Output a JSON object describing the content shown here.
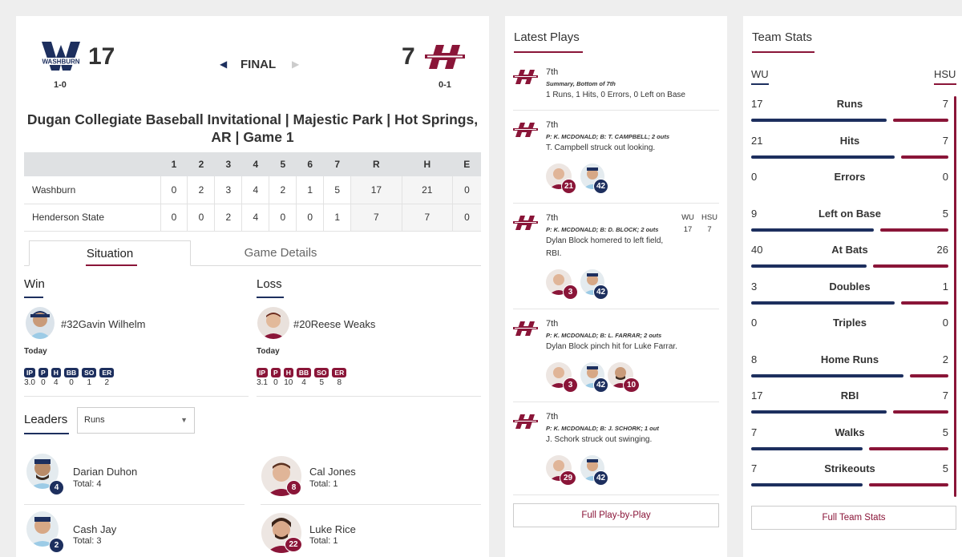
{
  "score": {
    "home_team_abbr": "WU",
    "home_score": "17",
    "home_record": "1-0",
    "away_team_abbr": "HSU",
    "away_score": "7",
    "away_record": "0-1",
    "status": "FINAL",
    "home_logo_text": "WASHBURN"
  },
  "game_title": "Dugan Collegiate Baseball Invitational | Majestic Park | Hot Springs, AR | Game 1",
  "linescore": {
    "headers": [
      "",
      "1",
      "2",
      "3",
      "4",
      "5",
      "6",
      "7",
      "R",
      "H",
      "E"
    ],
    "rows": [
      {
        "team": "Washburn",
        "innings": [
          "0",
          "2",
          "3",
          "4",
          "2",
          "1",
          "5"
        ],
        "r": "17",
        "h": "21",
        "e": "0"
      },
      {
        "team": "Henderson State",
        "innings": [
          "0",
          "0",
          "2",
          "4",
          "0",
          "0",
          "1"
        ],
        "r": "7",
        "h": "7",
        "e": "0"
      }
    ]
  },
  "tabs": {
    "situation": "Situation",
    "details": "Game Details"
  },
  "win": {
    "heading": "Win",
    "player": "#32Gavin Wilhelm",
    "when": "Today",
    "stats": [
      {
        "k": "IP",
        "v": "3.0"
      },
      {
        "k": "P",
        "v": "0"
      },
      {
        "k": "H",
        "v": "4"
      },
      {
        "k": "BB",
        "v": "0"
      },
      {
        "k": "SO",
        "v": "1"
      },
      {
        "k": "ER",
        "v": "2"
      }
    ]
  },
  "loss": {
    "heading": "Loss",
    "player": "#20Reese Weaks",
    "when": "Today",
    "stats": [
      {
        "k": "IP",
        "v": "3.1"
      },
      {
        "k": "P",
        "v": "0"
      },
      {
        "k": "H",
        "v": "10"
      },
      {
        "k": "BB",
        "v": "4"
      },
      {
        "k": "SO",
        "v": "5"
      },
      {
        "k": "ER",
        "v": "8"
      }
    ]
  },
  "leaders": {
    "heading": "Leaders",
    "select_value": "Runs",
    "items": [
      {
        "name": "Darian Duhon",
        "total": "Total: 4",
        "num": "4",
        "team": "wu"
      },
      {
        "name": "Cal Jones",
        "total": "Total: 1",
        "num": "8",
        "team": "hs"
      },
      {
        "name": "Cash Jay",
        "total": "Total: 3",
        "num": "2",
        "team": "wu"
      },
      {
        "name": "Luke Rice",
        "total": "Total: 1",
        "num": "22",
        "team": "hs"
      }
    ]
  },
  "latest_plays": {
    "heading": "Latest Plays",
    "plays": [
      {
        "inning": "7th",
        "sub": "Summary, Bottom of 7th",
        "desc": "1 Runs, 1 Hits, 0 Errors, 0 Left on Base"
      },
      {
        "inning": "7th",
        "sub": "P: K. MCDONALD; B: T. CAMPBELL; 2 outs",
        "desc": "T. Campbell struck out looking.",
        "badges": [
          "21",
          "42"
        ]
      },
      {
        "inning": "7th",
        "sub": "P: K. MCDONALD; B: D. BLOCK; 2 outs",
        "desc": "Dylan Block homered to left field, RBI.",
        "badges": [
          "3",
          "42"
        ],
        "score_head": [
          "WU",
          "HSU"
        ],
        "score_vals": [
          "17",
          "7"
        ]
      },
      {
        "inning": "7th",
        "sub": "P: K. MCDONALD; B: L. FARRAR; 2 outs",
        "desc": "Dylan Block pinch hit for Luke Farrar.",
        "badges": [
          "3",
          "42",
          "10"
        ]
      },
      {
        "inning": "7th",
        "sub": "P: K. MCDONALD; B: J. SCHORK; 1 out",
        "desc": "J. Schork struck out swinging.",
        "badges": [
          "29",
          "42"
        ]
      }
    ],
    "button": "Full Play-by-Play"
  },
  "team_stats": {
    "heading": "Team Stats",
    "left": "WU",
    "right": "HSU",
    "rows": [
      {
        "name": "Runs",
        "wu": "17",
        "hsu": "7"
      },
      {
        "name": "Hits",
        "wu": "21",
        "hsu": "7"
      },
      {
        "name": "Errors",
        "wu": "0",
        "hsu": "0"
      },
      {
        "name": "Left on Base",
        "wu": "9",
        "hsu": "5"
      },
      {
        "name": "At Bats",
        "wu": "40",
        "hsu": "26"
      },
      {
        "name": "Doubles",
        "wu": "3",
        "hsu": "1"
      },
      {
        "name": "Triples",
        "wu": "0",
        "hsu": "0"
      },
      {
        "name": "Home Runs",
        "wu": "8",
        "hsu": "2"
      },
      {
        "name": "RBI",
        "wu": "17",
        "hsu": "7"
      },
      {
        "name": "Walks",
        "wu": "7",
        "hsu": "5"
      },
      {
        "name": "Strikeouts",
        "wu": "7",
        "hsu": "5"
      }
    ],
    "button": "Full Team Stats"
  },
  "colors": {
    "wu": "#1d2f5e",
    "hsu": "#8a1538"
  }
}
